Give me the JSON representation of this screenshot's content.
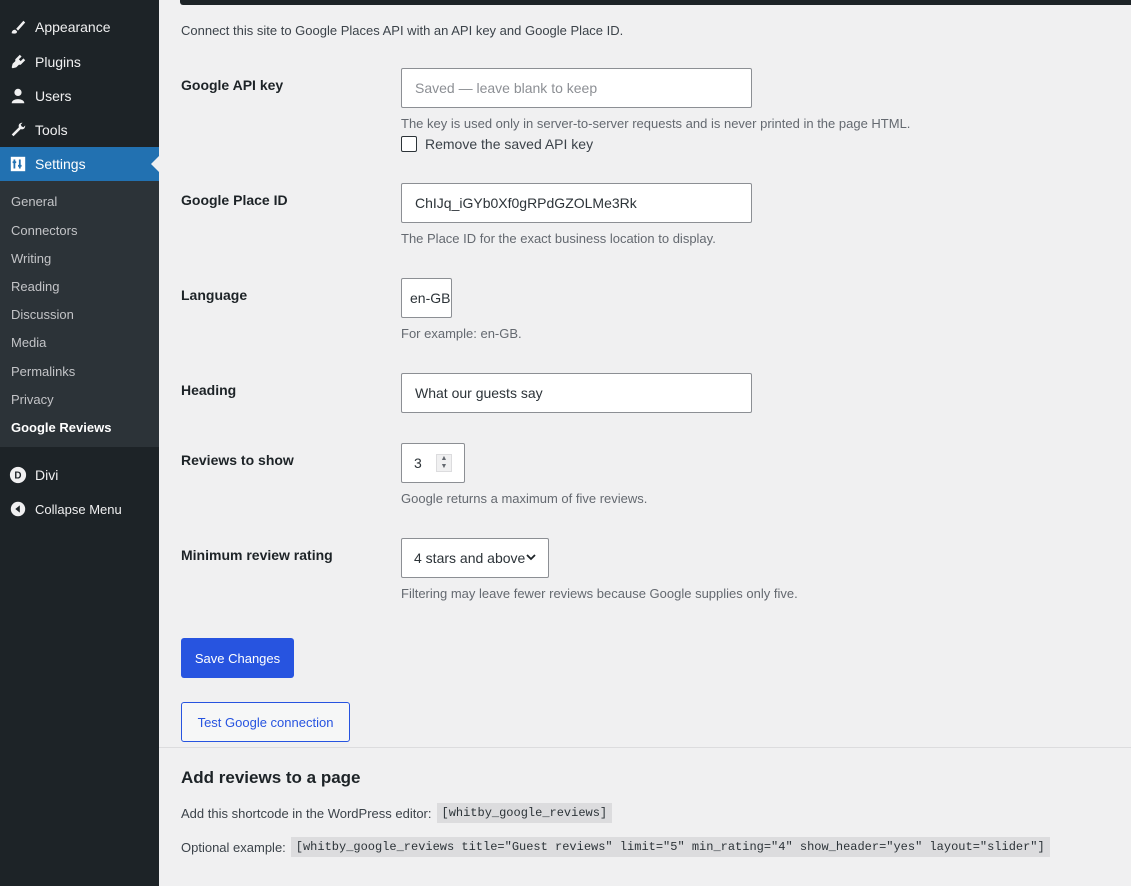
{
  "sidebar": {
    "menu": [
      {
        "label": "Appearance",
        "icon": "paintbrush-icon"
      },
      {
        "label": "Plugins",
        "icon": "plugin-icon"
      },
      {
        "label": "Users",
        "icon": "user-icon"
      },
      {
        "label": "Tools",
        "icon": "wrench-icon"
      },
      {
        "label": "Settings",
        "icon": "settings-icon"
      }
    ],
    "submenu": [
      "General",
      "Connectors",
      "Writing",
      "Reading",
      "Discussion",
      "Media",
      "Permalinks",
      "Privacy",
      "Google Reviews"
    ],
    "divi": "Divi",
    "collapse": "Collapse Menu"
  },
  "intro": "Connect this site to Google Places API with an API key and Google Place ID.",
  "fields": {
    "api_key": {
      "label": "Google API key",
      "placeholder": "Saved — leave blank to keep",
      "desc": "The key is used only in server-to-server requests and is never printed in the page HTML.",
      "remove_label": "Remove the saved API key"
    },
    "place_id": {
      "label": "Google Place ID",
      "value": "ChIJq_iGYb0Xf0gRPdGZOLMe3Rk",
      "desc": "The Place ID for the exact business location to display."
    },
    "language": {
      "label": "Language",
      "value": "en-GB",
      "desc": "For example: en-GB."
    },
    "heading": {
      "label": "Heading",
      "value": "What our guests say"
    },
    "reviews": {
      "label": "Reviews to show",
      "value": "3",
      "desc": "Google returns a maximum of five reviews."
    },
    "rating": {
      "label": "Minimum review rating",
      "value": "4 stars and above",
      "desc": "Filtering may leave fewer reviews because Google supplies only five."
    }
  },
  "buttons": {
    "save": "Save Changes",
    "test": "Test Google connection"
  },
  "shortcode": {
    "title": "Add reviews to a page",
    "line1_label": "Add this shortcode in the WordPress editor:",
    "line1_code": "[whitby_google_reviews]",
    "line2_label": "Optional example:",
    "line2_code": "[whitby_google_reviews title=\"Guest reviews\" limit=\"5\" min_rating=\"4\" show_header=\"yes\" layout=\"slider\"]"
  },
  "colors": {
    "sidebar_bg": "#1d2327",
    "submenu_bg": "#2c3338",
    "active_bg": "#2271b1",
    "primary_button": "#2754e0"
  }
}
